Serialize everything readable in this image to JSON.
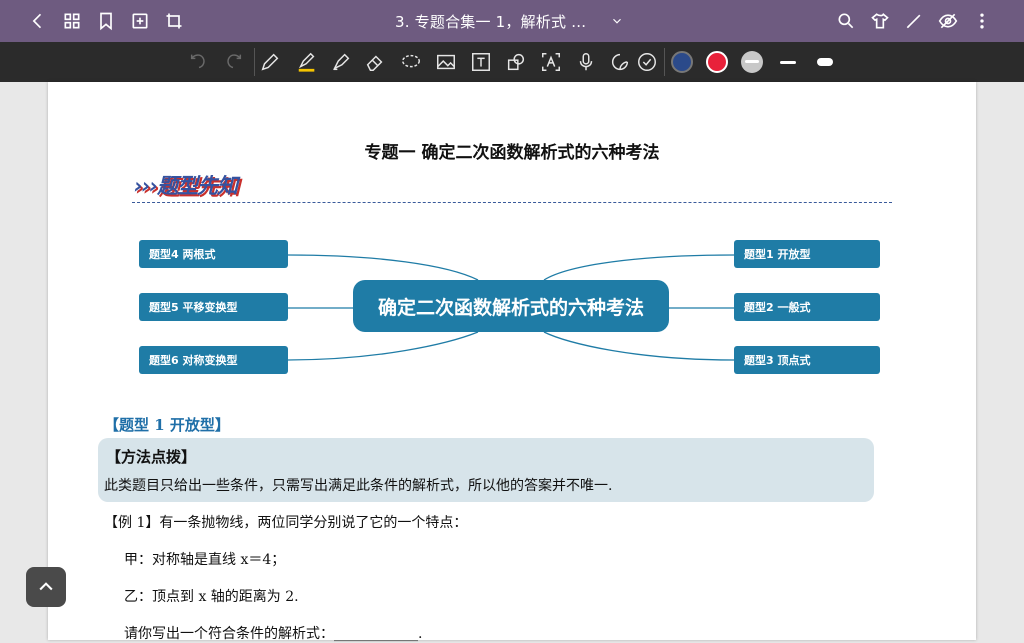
{
  "app": {
    "doc_title": "3. 专题合集一 1，解析式 …"
  },
  "colors": {
    "topbar": "#6e5b80",
    "toolbar": "#2b2b2b",
    "mindmap_blue": "#1f7ca6",
    "pen_navy": "#2b4a8a",
    "pen_red": "#e8213a",
    "pen_gray": "#c8c8c8"
  },
  "topbar": {
    "left_icons": [
      "back-icon",
      "grid-icon",
      "bookmark-icon",
      "add-page-icon",
      "crop-icon"
    ],
    "right_icons": [
      "search-icon",
      "shirt-icon",
      "pen-icon",
      "eye-off-icon",
      "more-vertical-icon"
    ]
  },
  "toolbar": {
    "tools": [
      "undo-icon",
      "redo-icon",
      "pencil-icon",
      "highlighter-icon",
      "marker-icon",
      "eraser-icon",
      "lasso-icon",
      "image-icon",
      "text-icon",
      "shape-icon",
      "ocr-icon",
      "mic-icon",
      "sticker-icon",
      "check-icon"
    ]
  },
  "document": {
    "title": "专题一  确定二次函数解析式的六种考法",
    "banner": "›››题型先知",
    "mindmap": {
      "center": "确定二次函数解析式的六种考法",
      "left": [
        "题型4  两根式",
        "题型5  平移变换型",
        "题型6  对称变换型"
      ],
      "right": [
        "题型1  开放型",
        "题型2  一般式",
        "题型3  顶点式"
      ]
    },
    "section_title": "【题型 1    开放型】",
    "method_title": "【方法点拨】",
    "method_text": "此类题目只给出一些条件，只需写出满足此条件的解析式，所以他的答案并不唯一.",
    "example_intro": "【例 1】有一条抛物线，两位同学分别说了它的一个特点：",
    "line_jia": "甲：对称轴是直线 x＝4；",
    "line_yi": "乙：顶点到 x 轴的距离为 2.",
    "line_ask": "请你写出一个符合条件的解析式：____________."
  }
}
